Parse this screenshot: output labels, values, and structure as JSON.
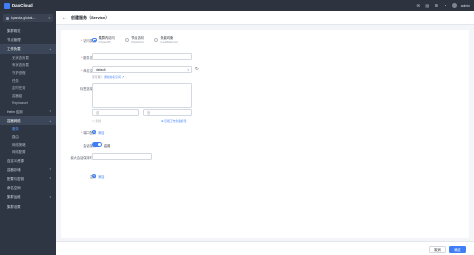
{
  "topbar": {
    "brand": "DaoCloud",
    "icons": [
      "chat-icon",
      "document-icon",
      "grid-icon",
      "bell-icon",
      "user-avatar"
    ],
    "username": "admin"
  },
  "sidebar": {
    "cluster_label": "kpanda-global-...",
    "items": [
      {
        "label": "集群概览",
        "level": 0
      },
      {
        "label": "节点管理",
        "level": 0
      },
      {
        "label": "工作负载",
        "level": 0,
        "active": true,
        "expanded": true
      },
      {
        "label": "无状态负载",
        "level": 1
      },
      {
        "label": "有状态负载",
        "level": 1
      },
      {
        "label": "守护进程",
        "level": 1
      },
      {
        "label": "任务",
        "level": 1
      },
      {
        "label": "定时任务",
        "level": 1
      },
      {
        "label": "容器组",
        "level": 1
      },
      {
        "label": "Replicaset",
        "level": 1
      },
      {
        "label": "Helm 应用",
        "level": 0,
        "caret": true
      },
      {
        "label": "容器网络",
        "level": 0,
        "active": true,
        "expanded": true
      },
      {
        "label": "服务",
        "level": 1,
        "active_sub": true
      },
      {
        "label": "路由",
        "level": 1
      },
      {
        "label": "网络策略",
        "level": 1
      },
      {
        "label": "网络配置",
        "level": 1
      },
      {
        "label": "自定义资源",
        "level": 0
      },
      {
        "label": "容器存储",
        "level": 0,
        "caret": true
      },
      {
        "label": "配置与密钥",
        "level": 0,
        "caret": true
      },
      {
        "label": "命名空间",
        "level": 0
      },
      {
        "label": "集群运维",
        "level": 0,
        "caret": true
      },
      {
        "label": "集群设置",
        "level": 0
      }
    ]
  },
  "header": {
    "title": "创建服务（Service）"
  },
  "form": {
    "access_type_label": "访问类型",
    "access_types": [
      {
        "title": "集群内访问",
        "sub": "(ClusterIP)",
        "selected": true
      },
      {
        "title": "节点访问",
        "sub": "(NodePort)",
        "selected": false
      },
      {
        "title": "负载均衡",
        "sub": "(LoadBalancer)",
        "selected": false
      }
    ],
    "service_name_label": "服务名称",
    "service_name_placeholder": "",
    "namespace_label": "命名空间",
    "namespace_value": "default",
    "namespace_hint_prefix": "无可用？",
    "namespace_hint_link": "添加命名空间",
    "label_selector_label": "标签选择器",
    "key_placeholder": "键",
    "value_placeholder": "值",
    "delete_label": "删除",
    "reference_link": "引用工作负载标签",
    "ports_label": "端口配置",
    "add_label": "添加",
    "session_label": "会话保持",
    "session_toggle_text": "启用",
    "timeout_label": "最大会话保持时间",
    "timeout_placeholder": "",
    "annotations_label": "注解"
  },
  "footer": {
    "cancel_label": "取消",
    "ok_label": "确定"
  },
  "colors": {
    "primary": "#3f7ef7",
    "sidebar_bg": "#2f3643",
    "topbar_bg": "#2d3440"
  }
}
